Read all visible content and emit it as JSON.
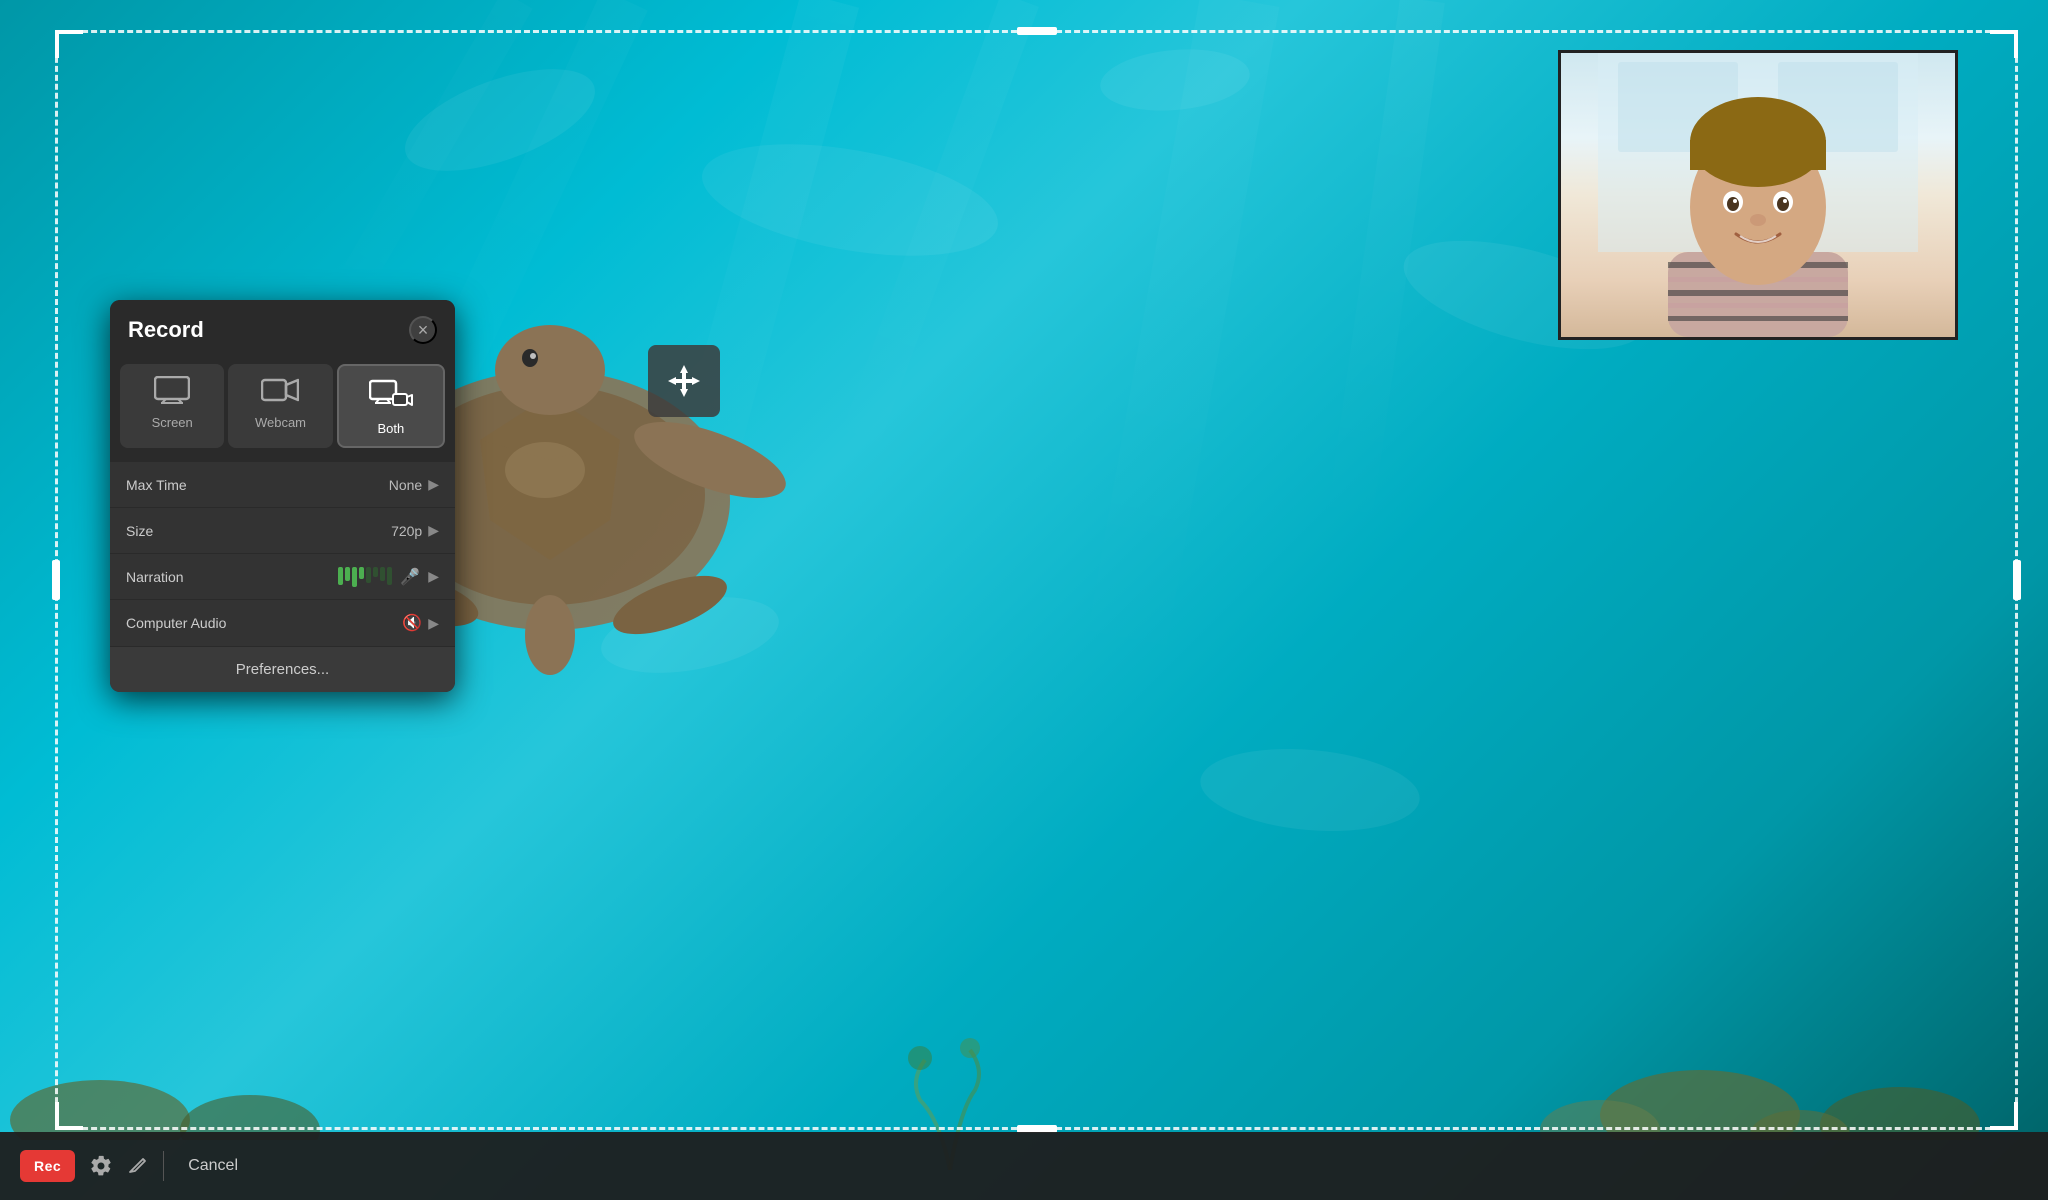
{
  "panel": {
    "title": "Record",
    "close_label": "×",
    "modes": [
      {
        "id": "screen",
        "label": "Screen",
        "icon": "🖥"
      },
      {
        "id": "webcam",
        "label": "Webcam",
        "icon": "📷"
      },
      {
        "id": "both",
        "label": "Both",
        "icon": "🖥📷",
        "active": true
      }
    ],
    "settings": [
      {
        "label": "Max Time",
        "value": "None"
      },
      {
        "label": "Size",
        "value": "720p"
      },
      {
        "label": "Narration",
        "value": ""
      },
      {
        "label": "Computer Audio",
        "value": ""
      }
    ],
    "preferences_label": "Preferences..."
  },
  "toolbar": {
    "rec_label": "Rec",
    "cancel_label": "Cancel"
  },
  "move_handle": {
    "icon": "⤢"
  }
}
